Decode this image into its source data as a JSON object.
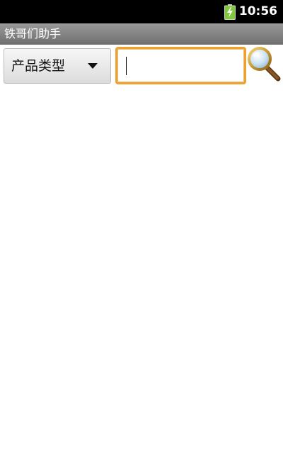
{
  "status_bar": {
    "time": "10:56",
    "battery_icon": "battery-charging-icon"
  },
  "app": {
    "title": "铁哥们助手"
  },
  "filter": {
    "selected": "产品类型"
  },
  "search": {
    "value": "",
    "icon": "magnifier-icon"
  },
  "colors": {
    "accent": "#f0a030",
    "battery": "#7fc93a"
  }
}
